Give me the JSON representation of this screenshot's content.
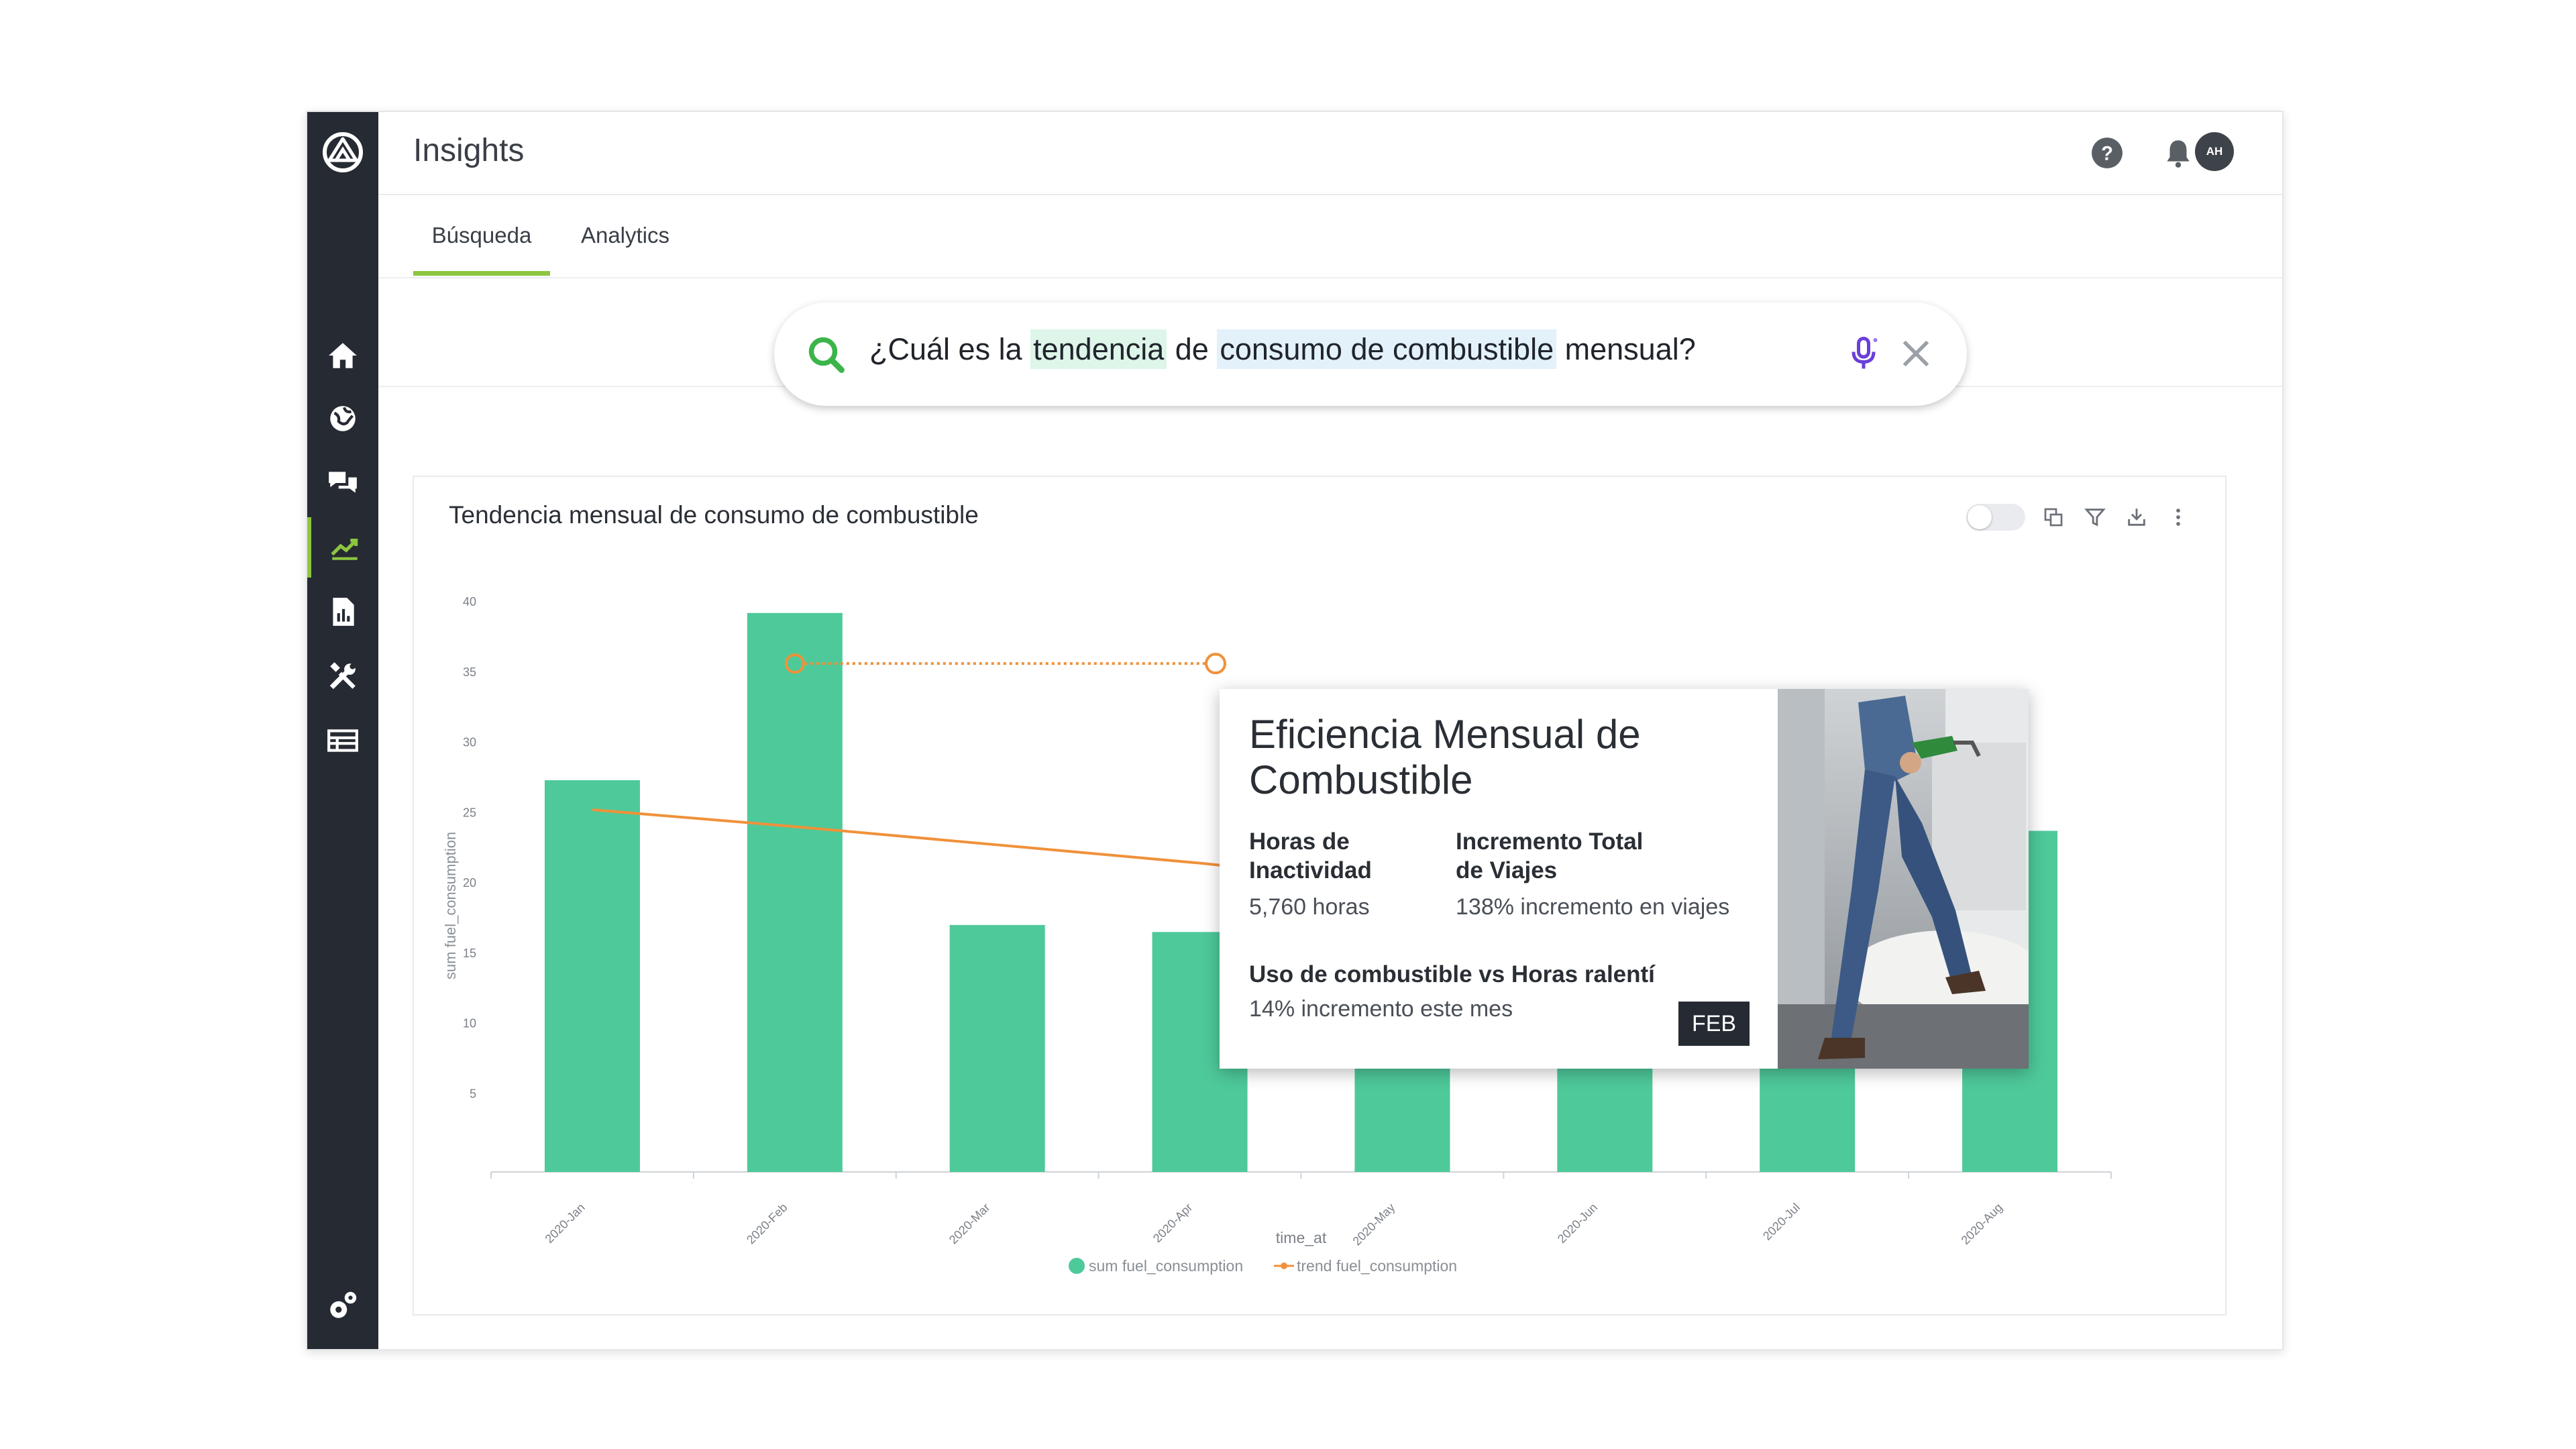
{
  "header": {
    "title": "Insights",
    "avatar_initials": "AH"
  },
  "sidebar": {
    "items": [
      {
        "name": "home",
        "icon": "home-icon"
      },
      {
        "name": "map",
        "icon": "globe-icon"
      },
      {
        "name": "messages",
        "icon": "chat-icon"
      },
      {
        "name": "insights",
        "icon": "trend-icon",
        "active": true
      },
      {
        "name": "reports",
        "icon": "report-icon"
      },
      {
        "name": "maintenance",
        "icon": "tools-icon"
      },
      {
        "name": "list",
        "icon": "list-icon"
      }
    ],
    "settings_icon": "settings-icon"
  },
  "tabs": [
    {
      "label": "Búsqueda",
      "active": true
    },
    {
      "label": "Analytics",
      "active": false
    }
  ],
  "search": {
    "prefix": "¿Cuál es la ",
    "highlight1": "tendencia",
    "middle": " de ",
    "highlight2": "consumo de combustible",
    "suffix": " mensual?"
  },
  "card": {
    "title": "Tendencia mensual de consumo de combustible"
  },
  "popup": {
    "title": "Eficiencia Mensual de Combustible",
    "label1": "Horas de Inactividad",
    "value1": "5,760 horas",
    "label2": "Incremento Total de Viajes",
    "value2": "138% incremento en viajes",
    "label3": "Uso de combustible vs Horas ralentí",
    "value3": "14% incremento este mes",
    "badge": "FEB"
  },
  "colors": {
    "bar": "#4ec99a",
    "trend": "#f0913a",
    "accent": "#8dc63f",
    "sidebar": "#252a33"
  },
  "chart_data": {
    "type": "bar",
    "categories": [
      "2020-Jan",
      "2020-Feb",
      "2020-Mar",
      "2020-Apr",
      "2020-May",
      "2020-Jun",
      "2020-Jul",
      "2020-Aug"
    ],
    "series": [
      {
        "name": "sum fuel_consumption",
        "type": "bar",
        "values": [
          27.3,
          39.2,
          17,
          16.5,
          16.5,
          16,
          21.8,
          23.7
        ]
      },
      {
        "name": "trend fuel_consumption",
        "type": "line",
        "values": [
          25.2,
          24,
          22.7,
          21.4,
          19.9,
          18,
          16.3,
          14.8
        ]
      }
    ],
    "xlabel": "time_at",
    "ylabel": "sum fuel_consumption",
    "yticks": [
      5,
      10,
      15,
      20,
      25,
      30,
      35,
      40
    ],
    "ylim": [
      0,
      40
    ],
    "legend_position": "bottom"
  }
}
